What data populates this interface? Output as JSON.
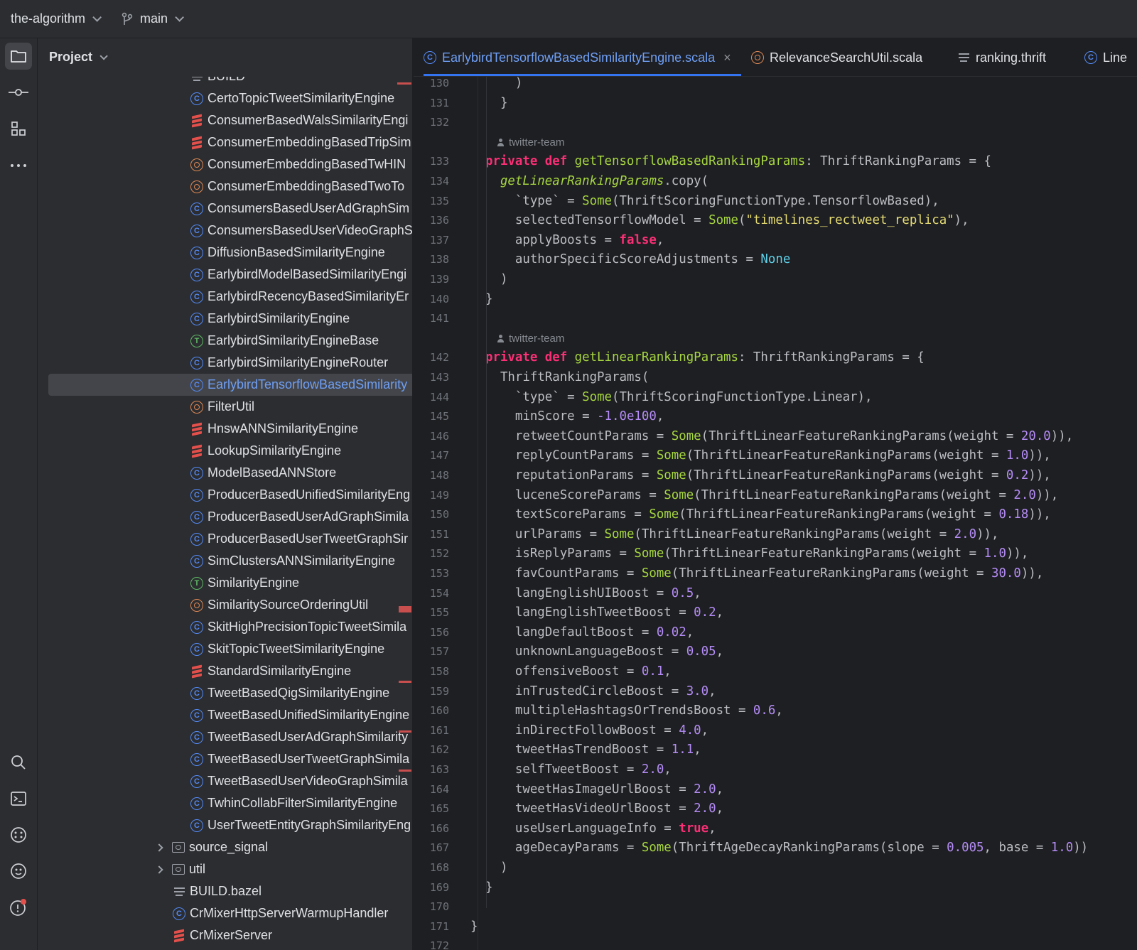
{
  "titlebar": {
    "project_name": "the-algorithm",
    "branch": "main"
  },
  "toolstrip": {
    "top_tools": [
      "project-folder-icon",
      "commit-icon",
      "structure-icon",
      "more-icon"
    ],
    "bottom_tools": [
      "search-icon",
      "terminal-icon",
      "services-icon",
      "plugins-icon",
      "problems-icon"
    ]
  },
  "project_panel": {
    "header": "Project",
    "items": [
      {
        "label": "BUILD",
        "icon": "build-file-icon",
        "indent": 1
      },
      {
        "label": "CertoTopicTweetSimilarityEngine",
        "icon": "class-icon",
        "indent": 1
      },
      {
        "label": "ConsumerBasedWalsSimilarityEngi",
        "icon": "scala-file-icon",
        "indent": 1
      },
      {
        "label": "ConsumerEmbeddingBasedTripSim",
        "icon": "scala-file-icon",
        "indent": 1
      },
      {
        "label": "ConsumerEmbeddingBasedTwHIN",
        "icon": "object-icon",
        "indent": 1
      },
      {
        "label": "ConsumerEmbeddingBasedTwoTo",
        "icon": "object-icon",
        "indent": 1
      },
      {
        "label": "ConsumersBasedUserAdGraphSim",
        "icon": "class-icon",
        "indent": 1
      },
      {
        "label": "ConsumersBasedUserVideoGraphS",
        "icon": "class-icon",
        "indent": 1
      },
      {
        "label": "DiffusionBasedSimilarityEngine",
        "icon": "class-icon",
        "indent": 1
      },
      {
        "label": "EarlybirdModelBasedSimilarityEngi",
        "icon": "class-icon",
        "indent": 1
      },
      {
        "label": "EarlybirdRecencyBasedSimilarityEr",
        "icon": "class-icon",
        "indent": 1
      },
      {
        "label": "EarlybirdSimilarityEngine",
        "icon": "class-icon",
        "indent": 1
      },
      {
        "label": "EarlybirdSimilarityEngineBase",
        "icon": "trait-icon",
        "indent": 1
      },
      {
        "label": "EarlybirdSimilarityEngineRouter",
        "icon": "class-icon",
        "indent": 1
      },
      {
        "label": "EarlybirdTensorflowBasedSimilarity",
        "icon": "class-icon",
        "indent": 1,
        "selected": true
      },
      {
        "label": "FilterUtil",
        "icon": "object-icon",
        "indent": 1
      },
      {
        "label": "HnswANNSimilarityEngine",
        "icon": "scala-file-icon",
        "indent": 1
      },
      {
        "label": "LookupSimilarityEngine",
        "icon": "scala-file-icon",
        "indent": 1
      },
      {
        "label": "ModelBasedANNStore",
        "icon": "class-icon",
        "indent": 1
      },
      {
        "label": "ProducerBasedUnifiedSimilarityEng",
        "icon": "class-icon",
        "indent": 1
      },
      {
        "label": "ProducerBasedUserAdGraphSimila",
        "icon": "class-icon",
        "indent": 1
      },
      {
        "label": "ProducerBasedUserTweetGraphSir",
        "icon": "class-icon",
        "indent": 1
      },
      {
        "label": "SimClustersANNSimilarityEngine",
        "icon": "class-icon",
        "indent": 1
      },
      {
        "label": "SimilarityEngine",
        "icon": "trait-icon",
        "indent": 1
      },
      {
        "label": "SimilaritySourceOrderingUtil",
        "icon": "object-icon",
        "indent": 1
      },
      {
        "label": "SkitHighPrecisionTopicTweetSimila",
        "icon": "class-icon",
        "indent": 1
      },
      {
        "label": "SkitTopicTweetSimilarityEngine",
        "icon": "class-icon",
        "indent": 1
      },
      {
        "label": "StandardSimilarityEngine",
        "icon": "scala-file-icon",
        "indent": 1
      },
      {
        "label": "TweetBasedQigSimilarityEngine",
        "icon": "class-icon",
        "indent": 1
      },
      {
        "label": "TweetBasedUnifiedSimilarityEngine",
        "icon": "class-icon",
        "indent": 1
      },
      {
        "label": "TweetBasedUserAdGraphSimilarity",
        "icon": "class-icon",
        "indent": 1
      },
      {
        "label": "TweetBasedUserTweetGraphSimila",
        "icon": "class-icon",
        "indent": 1
      },
      {
        "label": "TweetBasedUserVideoGraphSimila",
        "icon": "class-icon",
        "indent": 1
      },
      {
        "label": "TwhinCollabFilterSimilarityEngine",
        "icon": "class-icon",
        "indent": 1
      },
      {
        "label": "UserTweetEntityGraphSimilarityEng",
        "icon": "class-icon",
        "indent": 1
      },
      {
        "label": "source_signal",
        "icon": "folder-icon",
        "indent": 0,
        "expandable": true
      },
      {
        "label": "util",
        "icon": "folder-icon",
        "indent": 0,
        "expandable": true
      },
      {
        "label": "BUILD.bazel",
        "icon": "build-file-icon",
        "indent": 0
      },
      {
        "label": "CrMixerHttpServerWarmupHandler",
        "icon": "class-icon",
        "indent": 0
      },
      {
        "label": "CrMixerServer",
        "icon": "scala-file-icon",
        "indent": 0
      }
    ]
  },
  "tabs": [
    {
      "label": "EarlybirdTensorflowBasedSimilarityEngine.scala",
      "icon": "class-icon",
      "active": true,
      "close": "×"
    },
    {
      "label": "RelevanceSearchUtil.scala",
      "icon": "object-icon",
      "active": false
    },
    {
      "label": "ranking.thrift",
      "icon": "text-file-icon",
      "active": false
    },
    {
      "label": "Line",
      "icon": "class-icon",
      "active": false
    }
  ],
  "editor": {
    "author": "twitter-team",
    "lines": [
      {
        "n": "130",
        "tokens": [
          [
            "p",
            "    )"
          ]
        ]
      },
      {
        "n": "131",
        "tokens": [
          [
            "p",
            "  }"
          ]
        ]
      },
      {
        "n": "132",
        "tokens": []
      },
      {
        "author": true
      },
      {
        "n": "133",
        "tokens": [
          [
            "kw",
            "private def "
          ],
          [
            "fn",
            "getTensorflowBasedRankingParams"
          ],
          [
            "p",
            ": ThriftRankingParams = {"
          ]
        ]
      },
      {
        "n": "134",
        "tokens": [
          [
            "p",
            "  "
          ],
          [
            "fni",
            "getLinearRankingParams"
          ],
          [
            "p",
            ".copy("
          ]
        ]
      },
      {
        "n": "135",
        "tokens": [
          [
            "p",
            "    `type` = "
          ],
          [
            "fn",
            "Some"
          ],
          [
            "p",
            "(ThriftScoringFunctionType.TensorflowBased),"
          ]
        ]
      },
      {
        "n": "136",
        "tokens": [
          [
            "p",
            "    selectedTensorflowModel = "
          ],
          [
            "fn",
            "Some"
          ],
          [
            "p",
            "("
          ],
          [
            "str",
            "\"timelines_rectweet_replica\""
          ],
          [
            "p",
            "),"
          ]
        ]
      },
      {
        "n": "137",
        "tokens": [
          [
            "p",
            "    applyBoosts = "
          ],
          [
            "kw",
            "false"
          ],
          [
            "p",
            ","
          ]
        ]
      },
      {
        "n": "138",
        "tokens": [
          [
            "p",
            "    authorSpecificScoreAdjustments = "
          ],
          [
            "none",
            "None"
          ]
        ]
      },
      {
        "n": "139",
        "tokens": [
          [
            "p",
            "  )"
          ]
        ]
      },
      {
        "n": "140",
        "tokens": [
          [
            "p",
            "}"
          ]
        ]
      },
      {
        "n": "141",
        "tokens": []
      },
      {
        "author": true
      },
      {
        "n": "142",
        "tokens": [
          [
            "kw",
            "private def "
          ],
          [
            "fn",
            "getLinearRankingParams"
          ],
          [
            "p",
            ": ThriftRankingParams = {"
          ]
        ]
      },
      {
        "n": "143",
        "tokens": [
          [
            "p",
            "  ThriftRankingParams("
          ]
        ]
      },
      {
        "n": "144",
        "tokens": [
          [
            "p",
            "    `type` = "
          ],
          [
            "fn",
            "Some"
          ],
          [
            "p",
            "(ThriftScoringFunctionType.Linear),"
          ]
        ]
      },
      {
        "n": "145",
        "tokens": [
          [
            "p",
            "    minScore = "
          ],
          [
            "num",
            "-1.0e100"
          ],
          [
            "p",
            ","
          ]
        ]
      },
      {
        "n": "146",
        "tokens": [
          [
            "p",
            "    retweetCountParams = "
          ],
          [
            "fn",
            "Some"
          ],
          [
            "p",
            "(ThriftLinearFeatureRankingParams(weight = "
          ],
          [
            "num",
            "20.0"
          ],
          [
            "p",
            ")),"
          ]
        ]
      },
      {
        "n": "147",
        "tokens": [
          [
            "p",
            "    replyCountParams = "
          ],
          [
            "fn",
            "Some"
          ],
          [
            "p",
            "(ThriftLinearFeatureRankingParams(weight = "
          ],
          [
            "num",
            "1.0"
          ],
          [
            "p",
            ")),"
          ]
        ]
      },
      {
        "n": "148",
        "tokens": [
          [
            "p",
            "    reputationParams = "
          ],
          [
            "fn",
            "Some"
          ],
          [
            "p",
            "(ThriftLinearFeatureRankingParams(weight = "
          ],
          [
            "num",
            "0.2"
          ],
          [
            "p",
            ")),"
          ]
        ]
      },
      {
        "n": "149",
        "tokens": [
          [
            "p",
            "    luceneScoreParams = "
          ],
          [
            "fn",
            "Some"
          ],
          [
            "p",
            "(ThriftLinearFeatureRankingParams(weight = "
          ],
          [
            "num",
            "2.0"
          ],
          [
            "p",
            ")),"
          ]
        ]
      },
      {
        "n": "150",
        "tokens": [
          [
            "p",
            "    textScoreParams = "
          ],
          [
            "fn",
            "Some"
          ],
          [
            "p",
            "(ThriftLinearFeatureRankingParams(weight = "
          ],
          [
            "num",
            "0.18"
          ],
          [
            "p",
            ")),"
          ]
        ]
      },
      {
        "n": "151",
        "tokens": [
          [
            "p",
            "    urlParams = "
          ],
          [
            "fn",
            "Some"
          ],
          [
            "p",
            "(ThriftLinearFeatureRankingParams(weight = "
          ],
          [
            "num",
            "2.0"
          ],
          [
            "p",
            ")),"
          ]
        ]
      },
      {
        "n": "152",
        "tokens": [
          [
            "p",
            "    isReplyParams = "
          ],
          [
            "fn",
            "Some"
          ],
          [
            "p",
            "(ThriftLinearFeatureRankingParams(weight = "
          ],
          [
            "num",
            "1.0"
          ],
          [
            "p",
            ")),"
          ]
        ]
      },
      {
        "n": "153",
        "tokens": [
          [
            "p",
            "    favCountParams = "
          ],
          [
            "fn",
            "Some"
          ],
          [
            "p",
            "(ThriftLinearFeatureRankingParams(weight = "
          ],
          [
            "num",
            "30.0"
          ],
          [
            "p",
            ")),"
          ]
        ]
      },
      {
        "n": "154",
        "tokens": [
          [
            "p",
            "    langEnglishUIBoost = "
          ],
          [
            "num",
            "0.5"
          ],
          [
            "p",
            ","
          ]
        ]
      },
      {
        "n": "155",
        "tokens": [
          [
            "p",
            "    langEnglishTweetBoost = "
          ],
          [
            "num",
            "0.2"
          ],
          [
            "p",
            ","
          ]
        ]
      },
      {
        "n": "156",
        "tokens": [
          [
            "p",
            "    langDefaultBoost = "
          ],
          [
            "num",
            "0.02"
          ],
          [
            "p",
            ","
          ]
        ]
      },
      {
        "n": "157",
        "tokens": [
          [
            "p",
            "    unknownLanguageBoost = "
          ],
          [
            "num",
            "0.05"
          ],
          [
            "p",
            ","
          ]
        ]
      },
      {
        "n": "158",
        "tokens": [
          [
            "p",
            "    offensiveBoost = "
          ],
          [
            "num",
            "0.1"
          ],
          [
            "p",
            ","
          ]
        ]
      },
      {
        "n": "159",
        "tokens": [
          [
            "p",
            "    inTrustedCircleBoost = "
          ],
          [
            "num",
            "3.0"
          ],
          [
            "p",
            ","
          ]
        ]
      },
      {
        "n": "160",
        "tokens": [
          [
            "p",
            "    multipleHashtagsOrTrendsBoost = "
          ],
          [
            "num",
            "0.6"
          ],
          [
            "p",
            ","
          ]
        ]
      },
      {
        "n": "161",
        "tokens": [
          [
            "p",
            "    inDirectFollowBoost = "
          ],
          [
            "num",
            "4.0"
          ],
          [
            "p",
            ","
          ]
        ]
      },
      {
        "n": "162",
        "tokens": [
          [
            "p",
            "    tweetHasTrendBoost = "
          ],
          [
            "num",
            "1.1"
          ],
          [
            "p",
            ","
          ]
        ]
      },
      {
        "n": "163",
        "tokens": [
          [
            "p",
            "    selfTweetBoost = "
          ],
          [
            "num",
            "2.0"
          ],
          [
            "p",
            ","
          ]
        ]
      },
      {
        "n": "164",
        "tokens": [
          [
            "p",
            "    tweetHasImageUrlBoost = "
          ],
          [
            "num",
            "2.0"
          ],
          [
            "p",
            ","
          ]
        ]
      },
      {
        "n": "165",
        "tokens": [
          [
            "p",
            "    tweetHasVideoUrlBoost = "
          ],
          [
            "num",
            "2.0"
          ],
          [
            "p",
            ","
          ]
        ]
      },
      {
        "n": "166",
        "tokens": [
          [
            "p",
            "    useUserLanguageInfo = "
          ],
          [
            "kw",
            "true"
          ],
          [
            "p",
            ","
          ]
        ]
      },
      {
        "n": "167",
        "tokens": [
          [
            "p",
            "    ageDecayParams = "
          ],
          [
            "fn",
            "Some"
          ],
          [
            "p",
            "(ThriftAgeDecayRankingParams(slope = "
          ],
          [
            "num",
            "0.005"
          ],
          [
            "p",
            ", base = "
          ],
          [
            "num",
            "1.0"
          ],
          [
            "p",
            "))"
          ]
        ]
      },
      {
        "n": "168",
        "tokens": [
          [
            "p",
            "  )"
          ]
        ]
      },
      {
        "n": "169",
        "tokens": [
          [
            "p",
            "}"
          ]
        ]
      },
      {
        "n": "170",
        "tokens": []
      },
      {
        "n": "171",
        "tokens": [
          [
            "p",
            "}"
          ]
        ],
        "outer": true
      },
      {
        "n": "172",
        "tokens": []
      }
    ]
  },
  "colors": {
    "accent": "#3574f0",
    "keyword": "#fa2f75",
    "function": "#a6d640",
    "number": "#b48cf5",
    "string": "#e6dc74",
    "none": "#5fd0e8"
  }
}
